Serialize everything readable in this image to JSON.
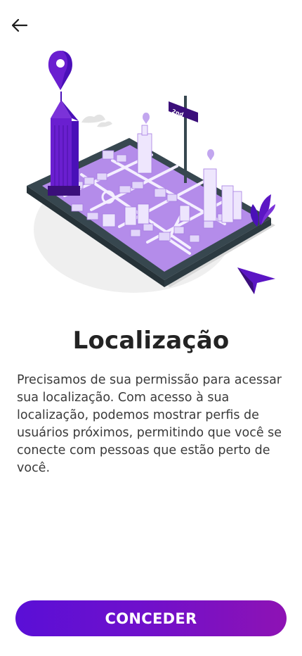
{
  "header": {
    "back_icon": "arrow-left-icon"
  },
  "illustration": {
    "name": "city-map-location-illustration",
    "street_sign": "2nd",
    "colors": {
      "purple_dark": "#4a10b8",
      "purple_main": "#7b32d9",
      "purple_light": "#c9b2f2",
      "tablet": "#37474f",
      "ground": "#efefef"
    }
  },
  "content": {
    "title": "Localização",
    "description": "Precisamos de sua permissão para acessar sua localização. Com acesso à sua localização, podemos mostrar perfis de usuários próximos, permitindo que você se conecte com pessoas que estão perto de você."
  },
  "actions": {
    "grant_label": "CONCEDER"
  },
  "theme": {
    "accent_start": "#5a0fd6",
    "accent_end": "#8e12b4",
    "text": "#2b2b2b"
  }
}
